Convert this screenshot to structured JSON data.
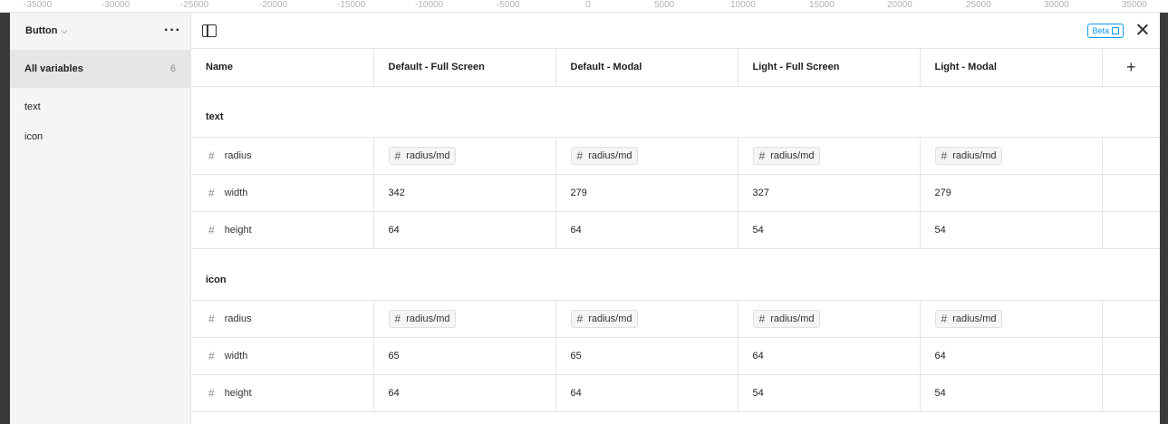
{
  "ruler": [
    "-35000",
    "-30000",
    "-25000",
    "-20000",
    "-15000",
    "-10000",
    "-5000",
    "0",
    "5000",
    "10000",
    "15000",
    "20000",
    "25000",
    "30000",
    "35000"
  ],
  "sidebar": {
    "collection_label": "Button",
    "all_variables_label": "All variables",
    "all_variables_count": "6",
    "groups": [
      "text",
      "icon"
    ]
  },
  "topbar": {
    "beta_label": "Beta"
  },
  "table": {
    "headers": [
      "Name",
      "Default - Full Screen",
      "Default - Modal",
      "Light - Full Screen",
      "Light - Modal"
    ],
    "groups": [
      {
        "name": "text",
        "rows": [
          {
            "name": "radius",
            "values": [
              "radius/md",
              "radius/md",
              "radius/md",
              "radius/md"
            ]
          },
          {
            "name": "width",
            "values": [
              "342",
              "279",
              "327",
              "279"
            ]
          },
          {
            "name": "height",
            "values": [
              "64",
              "64",
              "54",
              "54"
            ]
          }
        ]
      },
      {
        "name": "icon",
        "rows": [
          {
            "name": "radius",
            "values": [
              "radius/md",
              "radius/md",
              "radius/md",
              "radius/md"
            ]
          },
          {
            "name": "width",
            "values": [
              "65",
              "65",
              "64",
              "64"
            ]
          },
          {
            "name": "height",
            "values": [
              "64",
              "64",
              "54",
              "54"
            ]
          }
        ]
      }
    ]
  }
}
